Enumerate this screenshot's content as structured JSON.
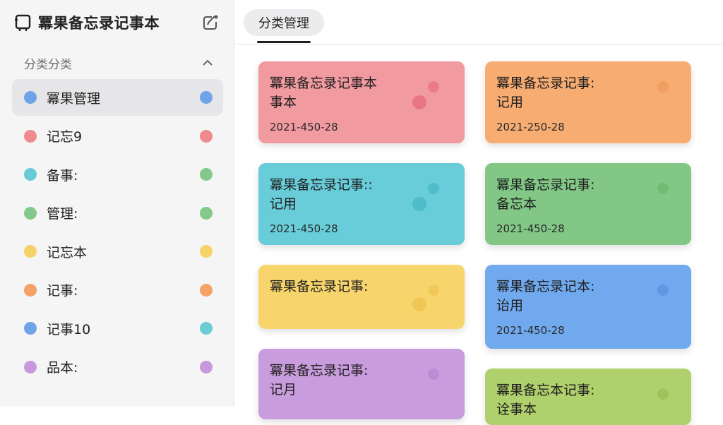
{
  "app": {
    "title": "冪果备忘录记事本"
  },
  "sidebar": {
    "section_title": "分类分类",
    "categories": [
      {
        "label": "冪果管理",
        "color": "#6fa3e8",
        "right_color": "#6fa3e8",
        "active": true
      },
      {
        "label": "记忘9",
        "color": "#ef8a8e",
        "right_color": "#ef8a8e",
        "active": false
      },
      {
        "label": "备事:",
        "color": "#67cad6",
        "right_color": "#84c98b",
        "active": false
      },
      {
        "label": "管理:",
        "color": "#84c98b",
        "right_color": "#84c98b",
        "active": false
      },
      {
        "label": "记忘本",
        "color": "#f7d268",
        "right_color": "#f7d268",
        "active": false
      },
      {
        "label": "记事:",
        "color": "#f5a266",
        "right_color": "#f5a266",
        "active": false
      },
      {
        "label": "记事10",
        "color": "#6fa3e8",
        "right_color": "#6ccbd3",
        "active": false
      },
      {
        "label": "品本:",
        "color": "#c898dc",
        "right_color": "#c898dc",
        "active": false
      }
    ]
  },
  "tabs": [
    {
      "label": "分类管理"
    }
  ],
  "notes": [
    {
      "title": "冪果备忘录记事本\n事本",
      "date": "2021-450-28",
      "color": "#f19aa0",
      "dot_color": "#e8707e"
    },
    {
      "title": "冪果备忘录记事:\n记用",
      "date": "2021-250-28",
      "color": "#f7ac72",
      "dot_color": "#ee9a5c"
    },
    {
      "title": "冪果备忘录记事::\n记用",
      "date": "2021-450-28",
      "color": "#68ccd9",
      "dot_color": "#4ab8c6"
    },
    {
      "title": "冪果备忘录记事:\n备忘本",
      "date": "2021-450-28",
      "color": "#82c785",
      "dot_color": "#6bb870"
    },
    {
      "title": "冪果备忘录记事:",
      "date": "",
      "color": "#f8d56c",
      "dot_color": "#efc454"
    },
    {
      "title": "冪果备忘录记本:\n诒用",
      "date": "2021-450-28",
      "color": "#71a9ee",
      "dot_color": "#5a91dd"
    },
    {
      "title": "冪果备忘录记事:\n记月",
      "date": "",
      "color": "#c99ddd",
      "dot_color": "#b786d0"
    },
    {
      "title": "冪果备忘本记事:\n诠事本",
      "date": "",
      "color": "#afd06c",
      "dot_color": "#9bc055"
    }
  ],
  "icons": {
    "app": "notebook-icon",
    "new": "new-note-icon",
    "chevron": "chevron-up-icon"
  }
}
